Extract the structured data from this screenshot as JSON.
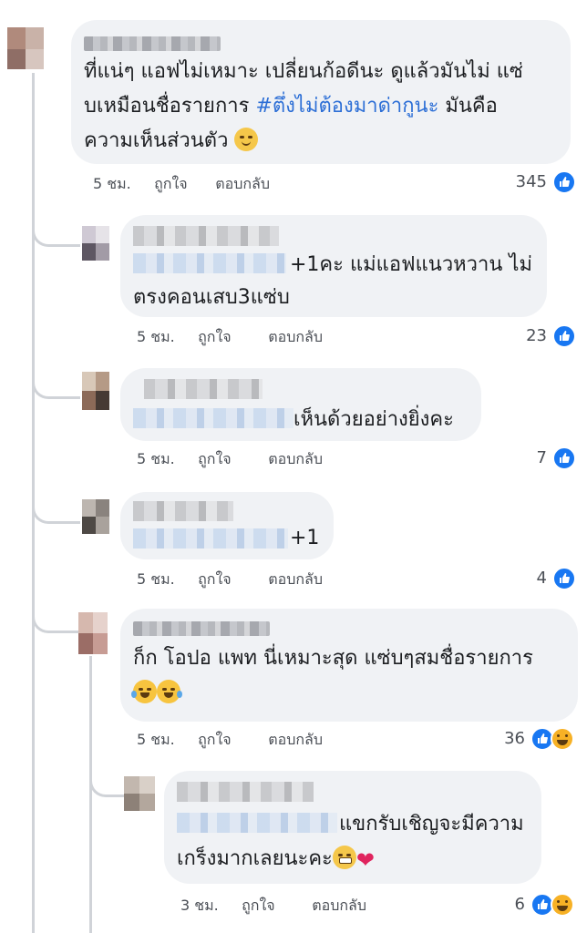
{
  "colors": {
    "bubble": "#f0f2f5",
    "like_blue": "#1877f2",
    "haha_yellow": "#f7b125",
    "hashtag_blue": "#2d6fd6",
    "meta_gray": "#4b4f56"
  },
  "actions": {
    "like": "ถูกใจ",
    "reply": "ตอบกลับ"
  },
  "comments": [
    {
      "lines": [
        "ที่แน่ๆ แอฟไม่เหมาะ  เปลี่ยนก้อดีนะ  ดูแล้วมันไม่ แซ่",
        "บเหมือนชื่อรายการ",
        "ความเห็นส่วนตัว"
      ],
      "hashtag": "#ตึ่งไม่ต้องมาด่ากูนะ",
      "after_hashtag": "มันคือ",
      "emoji": "relieved-face-icon",
      "time": "5 ชม.",
      "reactions": "345",
      "reaction_icons": [
        "like-icon"
      ]
    },
    {
      "lines": [
        "+1คะ แม่แอฟแนวหวาน ไม่",
        "ตรงคอนเสบ3แซ่บ"
      ],
      "time": "5 ชม.",
      "reactions": "23",
      "reaction_icons": [
        "like-icon"
      ]
    },
    {
      "lines": [
        "เห็นด้วยอย่างยิ่งคะ"
      ],
      "time": "5 ชม.",
      "reactions": "7",
      "reaction_icons": [
        "like-icon"
      ]
    },
    {
      "lines": [
        "+1"
      ],
      "time": "5 ชม.",
      "reactions": "4",
      "reaction_icons": [
        "like-icon"
      ]
    },
    {
      "lines": [
        "ก็ก  โอปอ  แพท  นี่เหมาะสุด  แซ่บๆสมชื่อรายการ"
      ],
      "emoji": "laughing-tears-icon",
      "time": "5 ชม.",
      "reactions": "36",
      "reaction_icons": [
        "like-icon",
        "haha-icon"
      ]
    },
    {
      "lines": [
        "แขกรับเชิญจะมีความ",
        "เกร็งมากเลยนะคะ"
      ],
      "emoji": "grimacing-face-icon",
      "heart": "❤",
      "time": "3 ชม.",
      "reactions": "6",
      "reaction_icons": [
        "like-icon",
        "haha-icon"
      ]
    }
  ]
}
